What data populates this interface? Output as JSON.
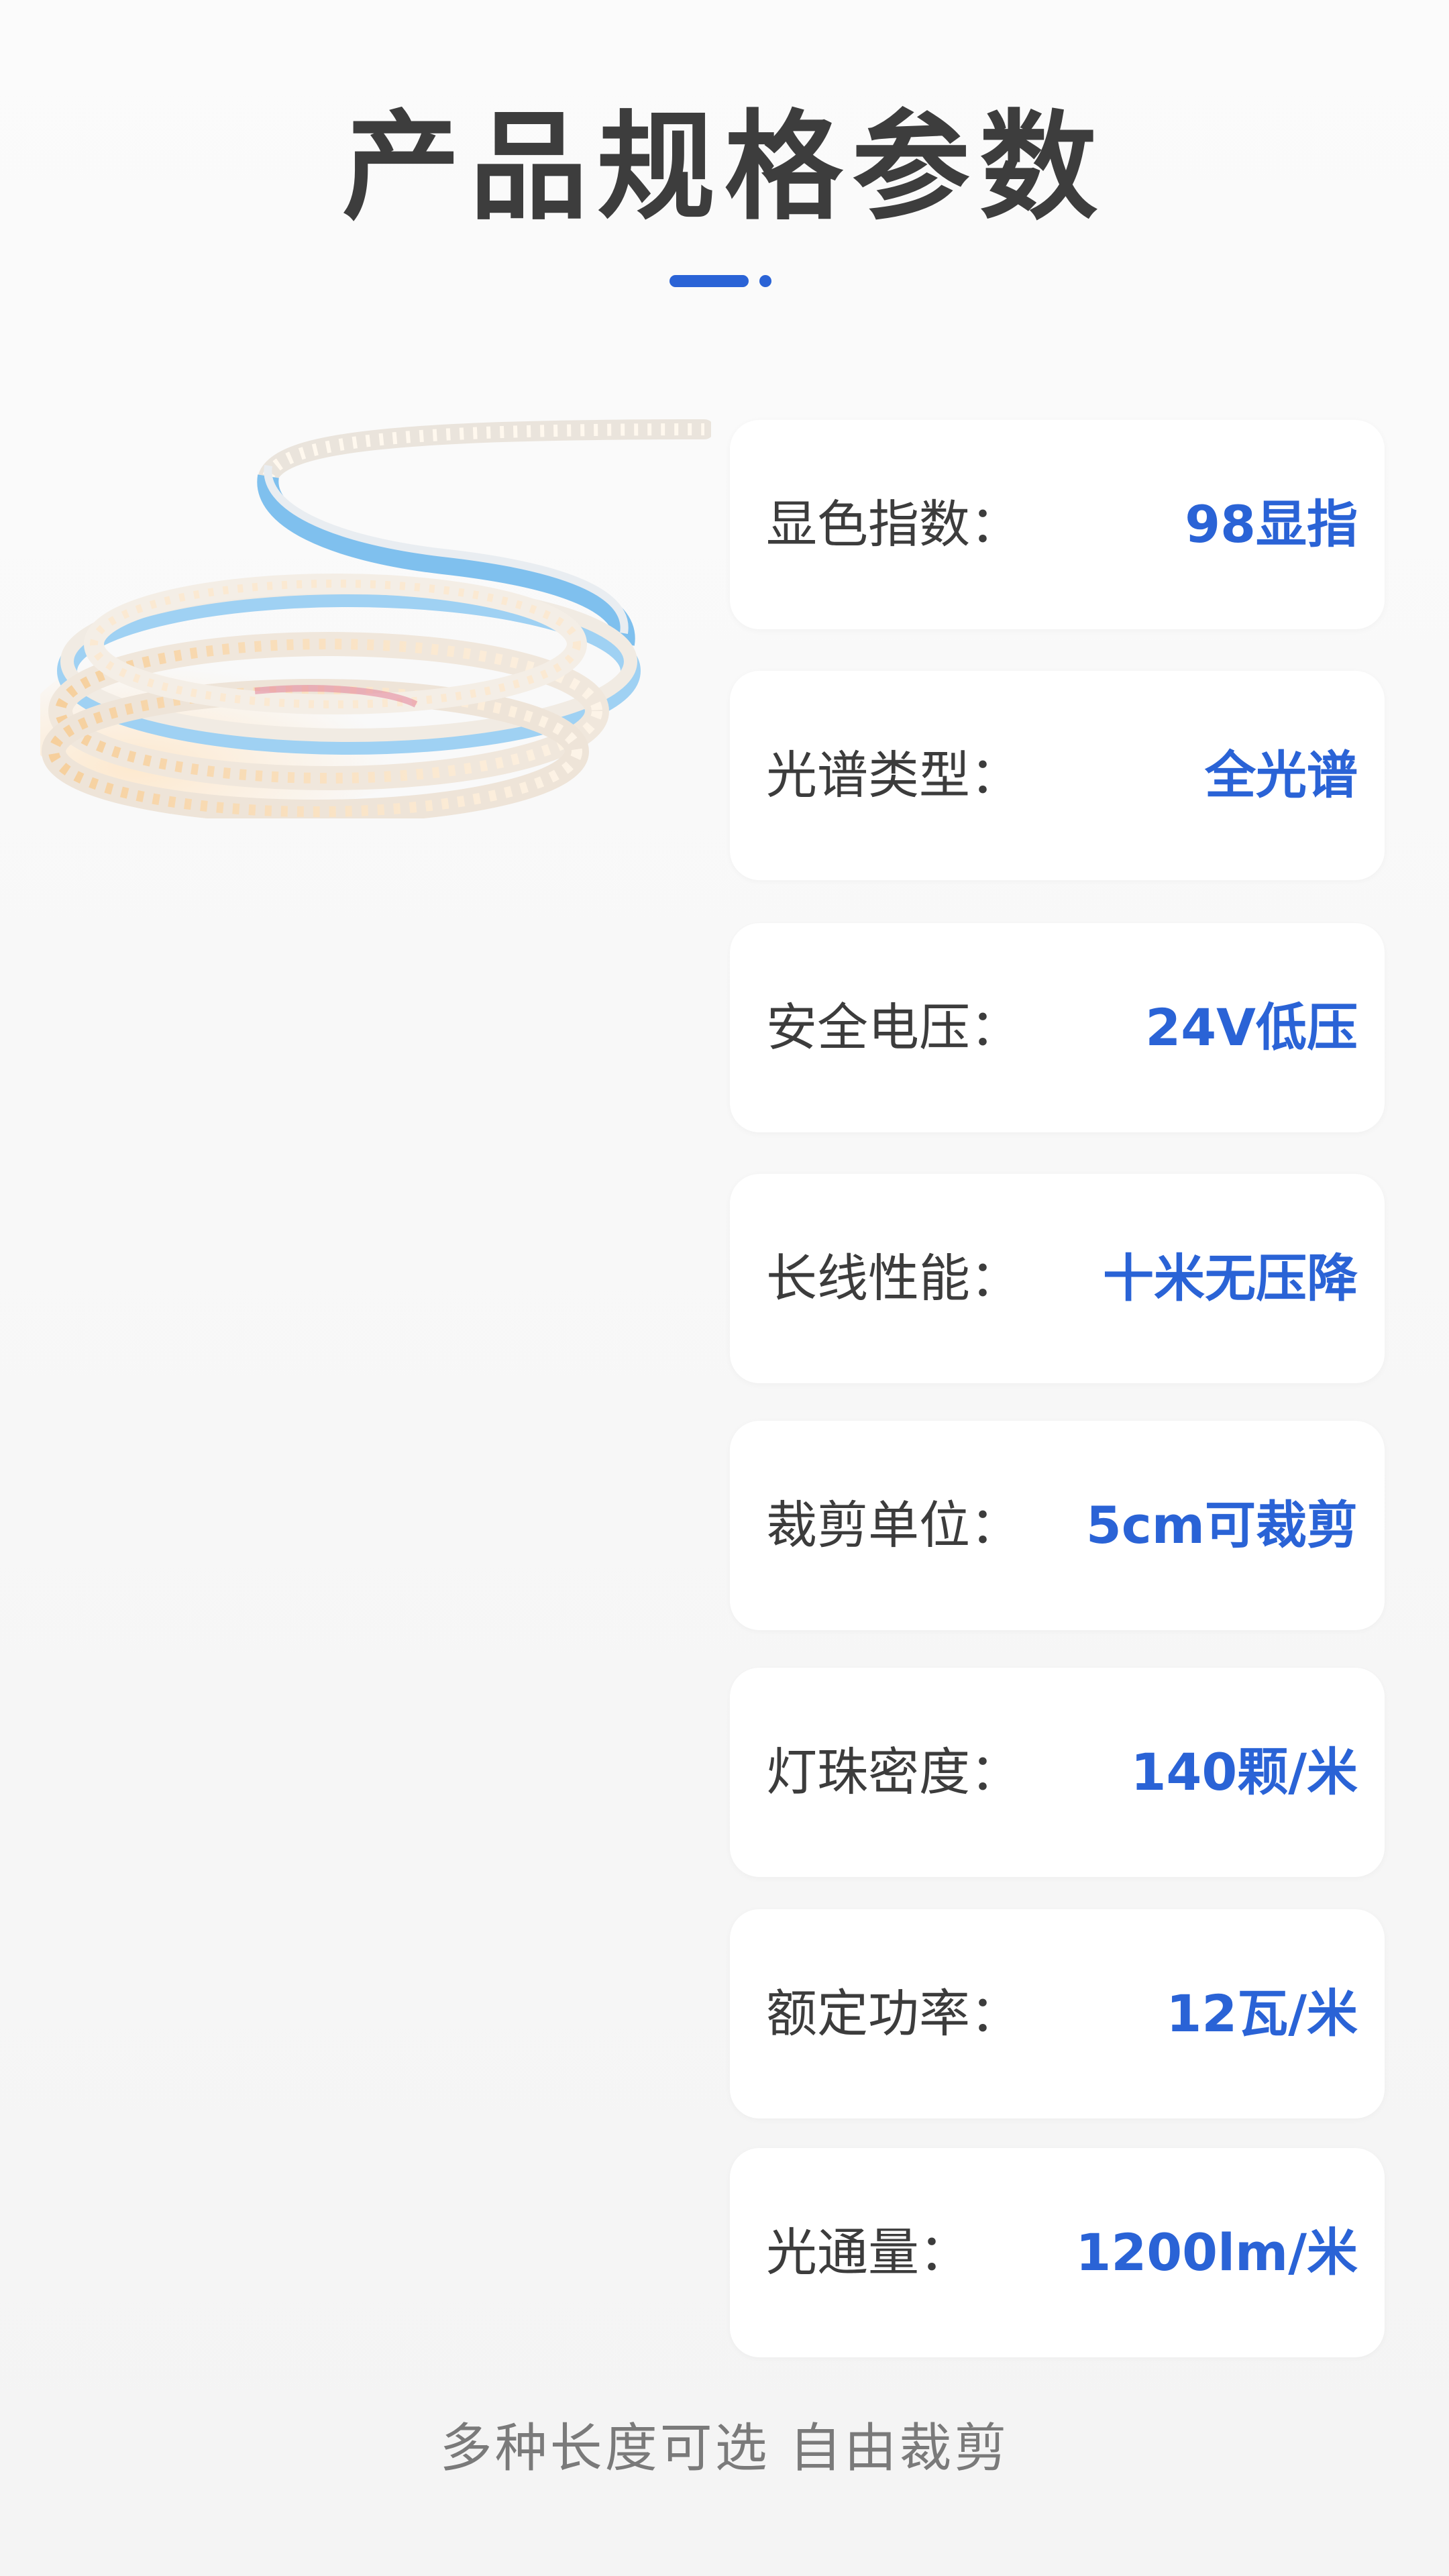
{
  "title": "产品规格参数",
  "specs": [
    {
      "label": "显色指数：",
      "value": "98显指"
    },
    {
      "label": "光谱类型：",
      "value": "全光谱"
    },
    {
      "label": "安全电压：",
      "value": "24V低压"
    },
    {
      "label": "长线性能：",
      "value": "十米无压降"
    },
    {
      "label": "裁剪单位：",
      "value": "5cm可裁剪"
    },
    {
      "label": "灯珠密度：",
      "value": "140颗/米"
    },
    {
      "label": "额定功率：",
      "value": "12瓦/米"
    },
    {
      "label": "光通量：",
      "value": "1200lm/米"
    }
  ],
  "footer": "多种长度可选 自由裁剪",
  "colors": {
    "accent": "#2a63d6",
    "title": "#3d3d3d",
    "background": "#f7f7f7",
    "card": "#ffffff"
  },
  "icons": {
    "title_accent": "dash-dot-accent",
    "product": "led-strip-coil-image"
  }
}
